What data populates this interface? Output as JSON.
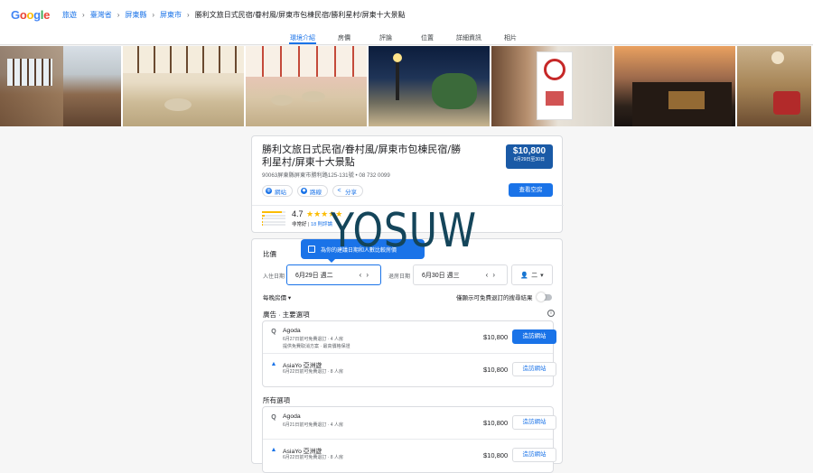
{
  "header": {
    "logo": "Google",
    "logo_colors": [
      "#4285f4",
      "#ea4335",
      "#fbbc05",
      "#4285f4",
      "#34a853",
      "#ea4335"
    ],
    "breadcrumbs": [
      "旅遊",
      "臺灣省",
      "屏東縣",
      "屏東市",
      "勝利文旅日式民宿/眷村風/屏東市包棟民宿/勝利星村/屏東十大景點"
    ]
  },
  "tabs": [
    {
      "label": "環境介紹",
      "active": true
    },
    {
      "label": "房價",
      "active": false
    },
    {
      "label": "評論",
      "active": false
    },
    {
      "label": "位置",
      "active": false
    },
    {
      "label": "詳細資訊",
      "active": false
    },
    {
      "label": "相片",
      "active": false
    }
  ],
  "hotel": {
    "name": "勝利文旅日式民宿/眷村風/屏東市包棟民宿/勝利星村/屏東十大景點",
    "address": "90063屏東縣屏東市勝利路125-131號 • 08 732 0099",
    "actions": [
      {
        "label": "網站",
        "icon": "globe-icon"
      },
      {
        "label": "路線",
        "icon": "directions-icon"
      },
      {
        "label": "分享",
        "icon": "share-icon"
      }
    ],
    "price": "$10,800",
    "price_dates": "6月29日至30日",
    "check_button": "查看空房",
    "rating": "4.7",
    "stars": "★★★★★",
    "rating_label": "非常好",
    "review_count": "18 則評論",
    "rating_distribution": [
      0.85,
      0.1,
      0.03,
      0.01,
      0.01
    ]
  },
  "watermark": "YOSUW",
  "compare": {
    "title": "比價",
    "tooltip": "為你的建議日期和人數比較房價",
    "checkin_label": "入住日期",
    "checkin_value": "6月29日 週二",
    "checkout_label": "退房日期",
    "checkout_value": "6月30日 週三",
    "guests": "二",
    "night_selector": "每晚房價",
    "toggle_label": "僅顯示可免費退訂的搜尋結果",
    "ad_section_title": "廣告 · 主要選項",
    "all_section_title": "所有選項",
    "ad_offers": [
      {
        "name": "Agoda",
        "sub1": "6月27日前可免費退訂 · 4 人房",
        "sub2": "提供免費取消方案 · 最高價格保證",
        "price": "$10,800",
        "button": "造訪網站",
        "primary": true,
        "logo": "Q"
      },
      {
        "name": "AsiaYo 亞洲遊",
        "sub1": "6月22日前可免費退訂 · 8 人房",
        "sub2": "",
        "price": "$10,800",
        "button": "造訪網站",
        "primary": false,
        "logo": "▲"
      }
    ],
    "all_offers": [
      {
        "name": "Agoda",
        "sub1": "6月21日前可免費退訂 · 4 人房",
        "price": "$10,800",
        "button": "造訪網站",
        "logo": "Q"
      },
      {
        "name": "AsiaYo 亞洲遊",
        "sub1": "6月22日前可免費退訂 · 8 人房",
        "price": "$10,800",
        "button": "造訪網站",
        "logo": "▲"
      }
    ]
  }
}
